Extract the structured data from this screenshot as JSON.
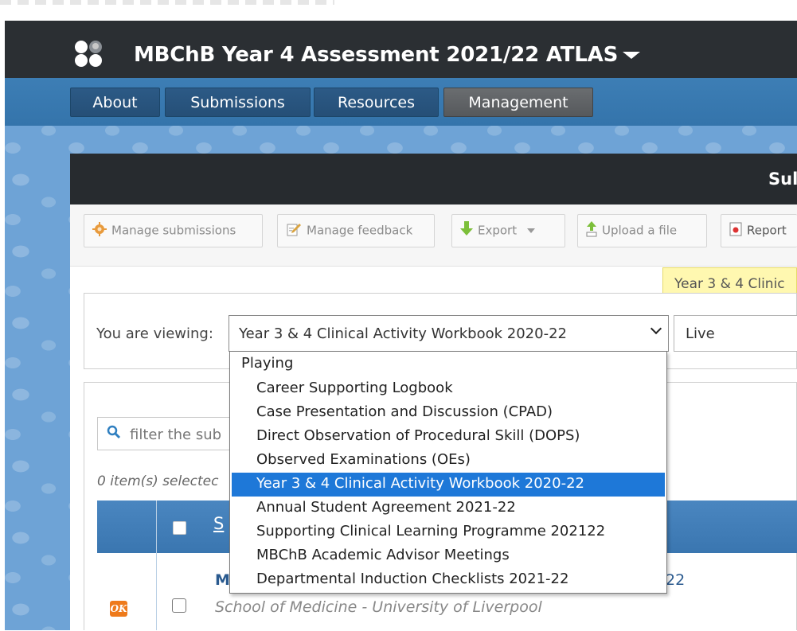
{
  "header": {
    "title": "MBChB Year 4 Assessment 2021/22 ATLAS"
  },
  "nav": {
    "items": [
      {
        "label": "About"
      },
      {
        "label": "Submissions"
      },
      {
        "label": "Resources"
      },
      {
        "label": "Management",
        "active": true
      }
    ]
  },
  "card": {
    "title": "Sul"
  },
  "toolbar": {
    "manage_submissions": "Manage submissions",
    "manage_feedback": "Manage feedback",
    "export": "Export",
    "upload": "Upload a file",
    "report": "Report"
  },
  "tooltip": {
    "text": "Year 3 & 4 Clinic"
  },
  "viewing": {
    "label": "You are viewing:",
    "selected": "Year 3 & 4 Clinical Activity Workbook 2020-22",
    "status": "Live"
  },
  "dropdown": {
    "group": "Playing",
    "options": [
      "Career Supporting Logbook",
      "Case Presentation and Discussion (CPAD)",
      "Direct Observation of Procedural Skill (DOPS)",
      "Observed Examinations (OEs)",
      "Year 3 & 4 Clinical Activity Workbook 2020-22",
      "Annual Student Agreement 2021-22",
      "Supporting Clinical Learning Programme 202122",
      "MBChB Academic Advisor Meetings",
      "Departmental Induction Checklists 2021-22"
    ],
    "selected_index": 4
  },
  "list": {
    "filter_placeholder": "filter the sub",
    "selection_count": "0 item(s) selectec",
    "column_header": "S",
    "row": {
      "title_start": "M",
      "title_end": "22",
      "subtitle": "School of Medicine - University of Liverpool",
      "status_icon": "OK"
    }
  },
  "colors": {
    "header_bg": "#2b2f33",
    "nav_bg": "#3474ab",
    "selection": "#1e78d8",
    "tooltip_bg": "#fff8b0"
  }
}
